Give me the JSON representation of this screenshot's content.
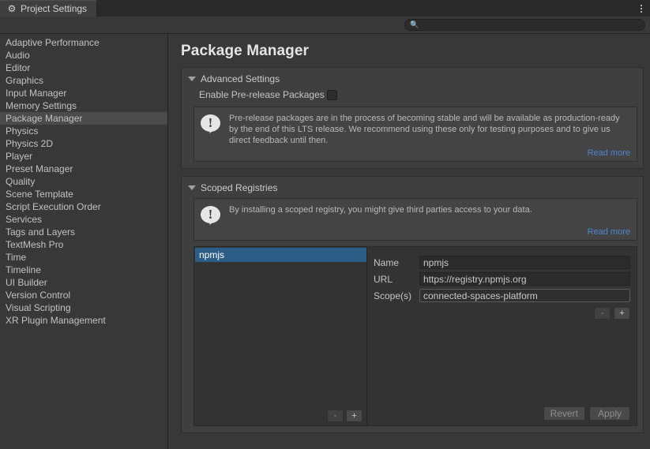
{
  "window": {
    "tab_label": "Project Settings",
    "gear_icon": "gear-icon",
    "kebab_icon": "more-options-icon"
  },
  "search": {
    "value": "",
    "placeholder": "",
    "icon": "search-icon"
  },
  "sidebar": {
    "items": [
      {
        "label": "Adaptive Performance",
        "selected": false
      },
      {
        "label": "Audio",
        "selected": false
      },
      {
        "label": "Editor",
        "selected": false
      },
      {
        "label": "Graphics",
        "selected": false
      },
      {
        "label": "Input Manager",
        "selected": false
      },
      {
        "label": "Memory Settings",
        "selected": false
      },
      {
        "label": "Package Manager",
        "selected": true
      },
      {
        "label": "Physics",
        "selected": false
      },
      {
        "label": "Physics 2D",
        "selected": false
      },
      {
        "label": "Player",
        "selected": false
      },
      {
        "label": "Preset Manager",
        "selected": false
      },
      {
        "label": "Quality",
        "selected": false
      },
      {
        "label": "Scene Template",
        "selected": false
      },
      {
        "label": "Script Execution Order",
        "selected": false
      },
      {
        "label": "Services",
        "selected": false
      },
      {
        "label": "Tags and Layers",
        "selected": false
      },
      {
        "label": "TextMesh Pro",
        "selected": false
      },
      {
        "label": "Time",
        "selected": false
      },
      {
        "label": "Timeline",
        "selected": false
      },
      {
        "label": "UI Builder",
        "selected": false
      },
      {
        "label": "Version Control",
        "selected": false
      },
      {
        "label": "Visual Scripting",
        "selected": false
      },
      {
        "label": "XR Plugin Management",
        "selected": false
      }
    ]
  },
  "page": {
    "title": "Package Manager"
  },
  "advanced_settings": {
    "header": "Advanced Settings",
    "expanded": true,
    "prerelease_label": "Enable Pre-release Packages",
    "prerelease_checked": false,
    "info_text": "Pre-release packages are in the process of becoming stable and will be available as production-ready by the end of this LTS release. We recommend using these only for testing purposes and to give us direct feedback until then.",
    "read_more_label": "Read more",
    "info_icon": "info-exclamation-icon"
  },
  "scoped_registries": {
    "header": "Scoped Registries",
    "expanded": true,
    "info_text": "By installing a scoped registry, you might give third parties access to your data.",
    "read_more_label": "Read more",
    "info_icon": "info-exclamation-icon",
    "list": [
      {
        "label": "npmjs",
        "selected": true
      }
    ],
    "list_remove_label": "-",
    "list_add_label": "+",
    "fields": [
      {
        "label": "Name",
        "value": "npmjs",
        "focused": false
      },
      {
        "label": "URL",
        "value": "https://registry.npmjs.org",
        "focused": false
      },
      {
        "label": "Scope(s)",
        "value": "connected-spaces-platform",
        "focused": true
      }
    ],
    "scope_remove_label": "-",
    "scope_add_label": "+",
    "revert_label": "Revert",
    "apply_label": "Apply"
  },
  "colors": {
    "window_bg": "#383838",
    "panel_bg": "#3f3f3f",
    "tabbar_bg": "#292929",
    "selection_blue": "#2c5d87",
    "link_blue": "#4d87d1",
    "sidebar_selected": "#4b4b4b",
    "text": "#c4c4c4"
  }
}
